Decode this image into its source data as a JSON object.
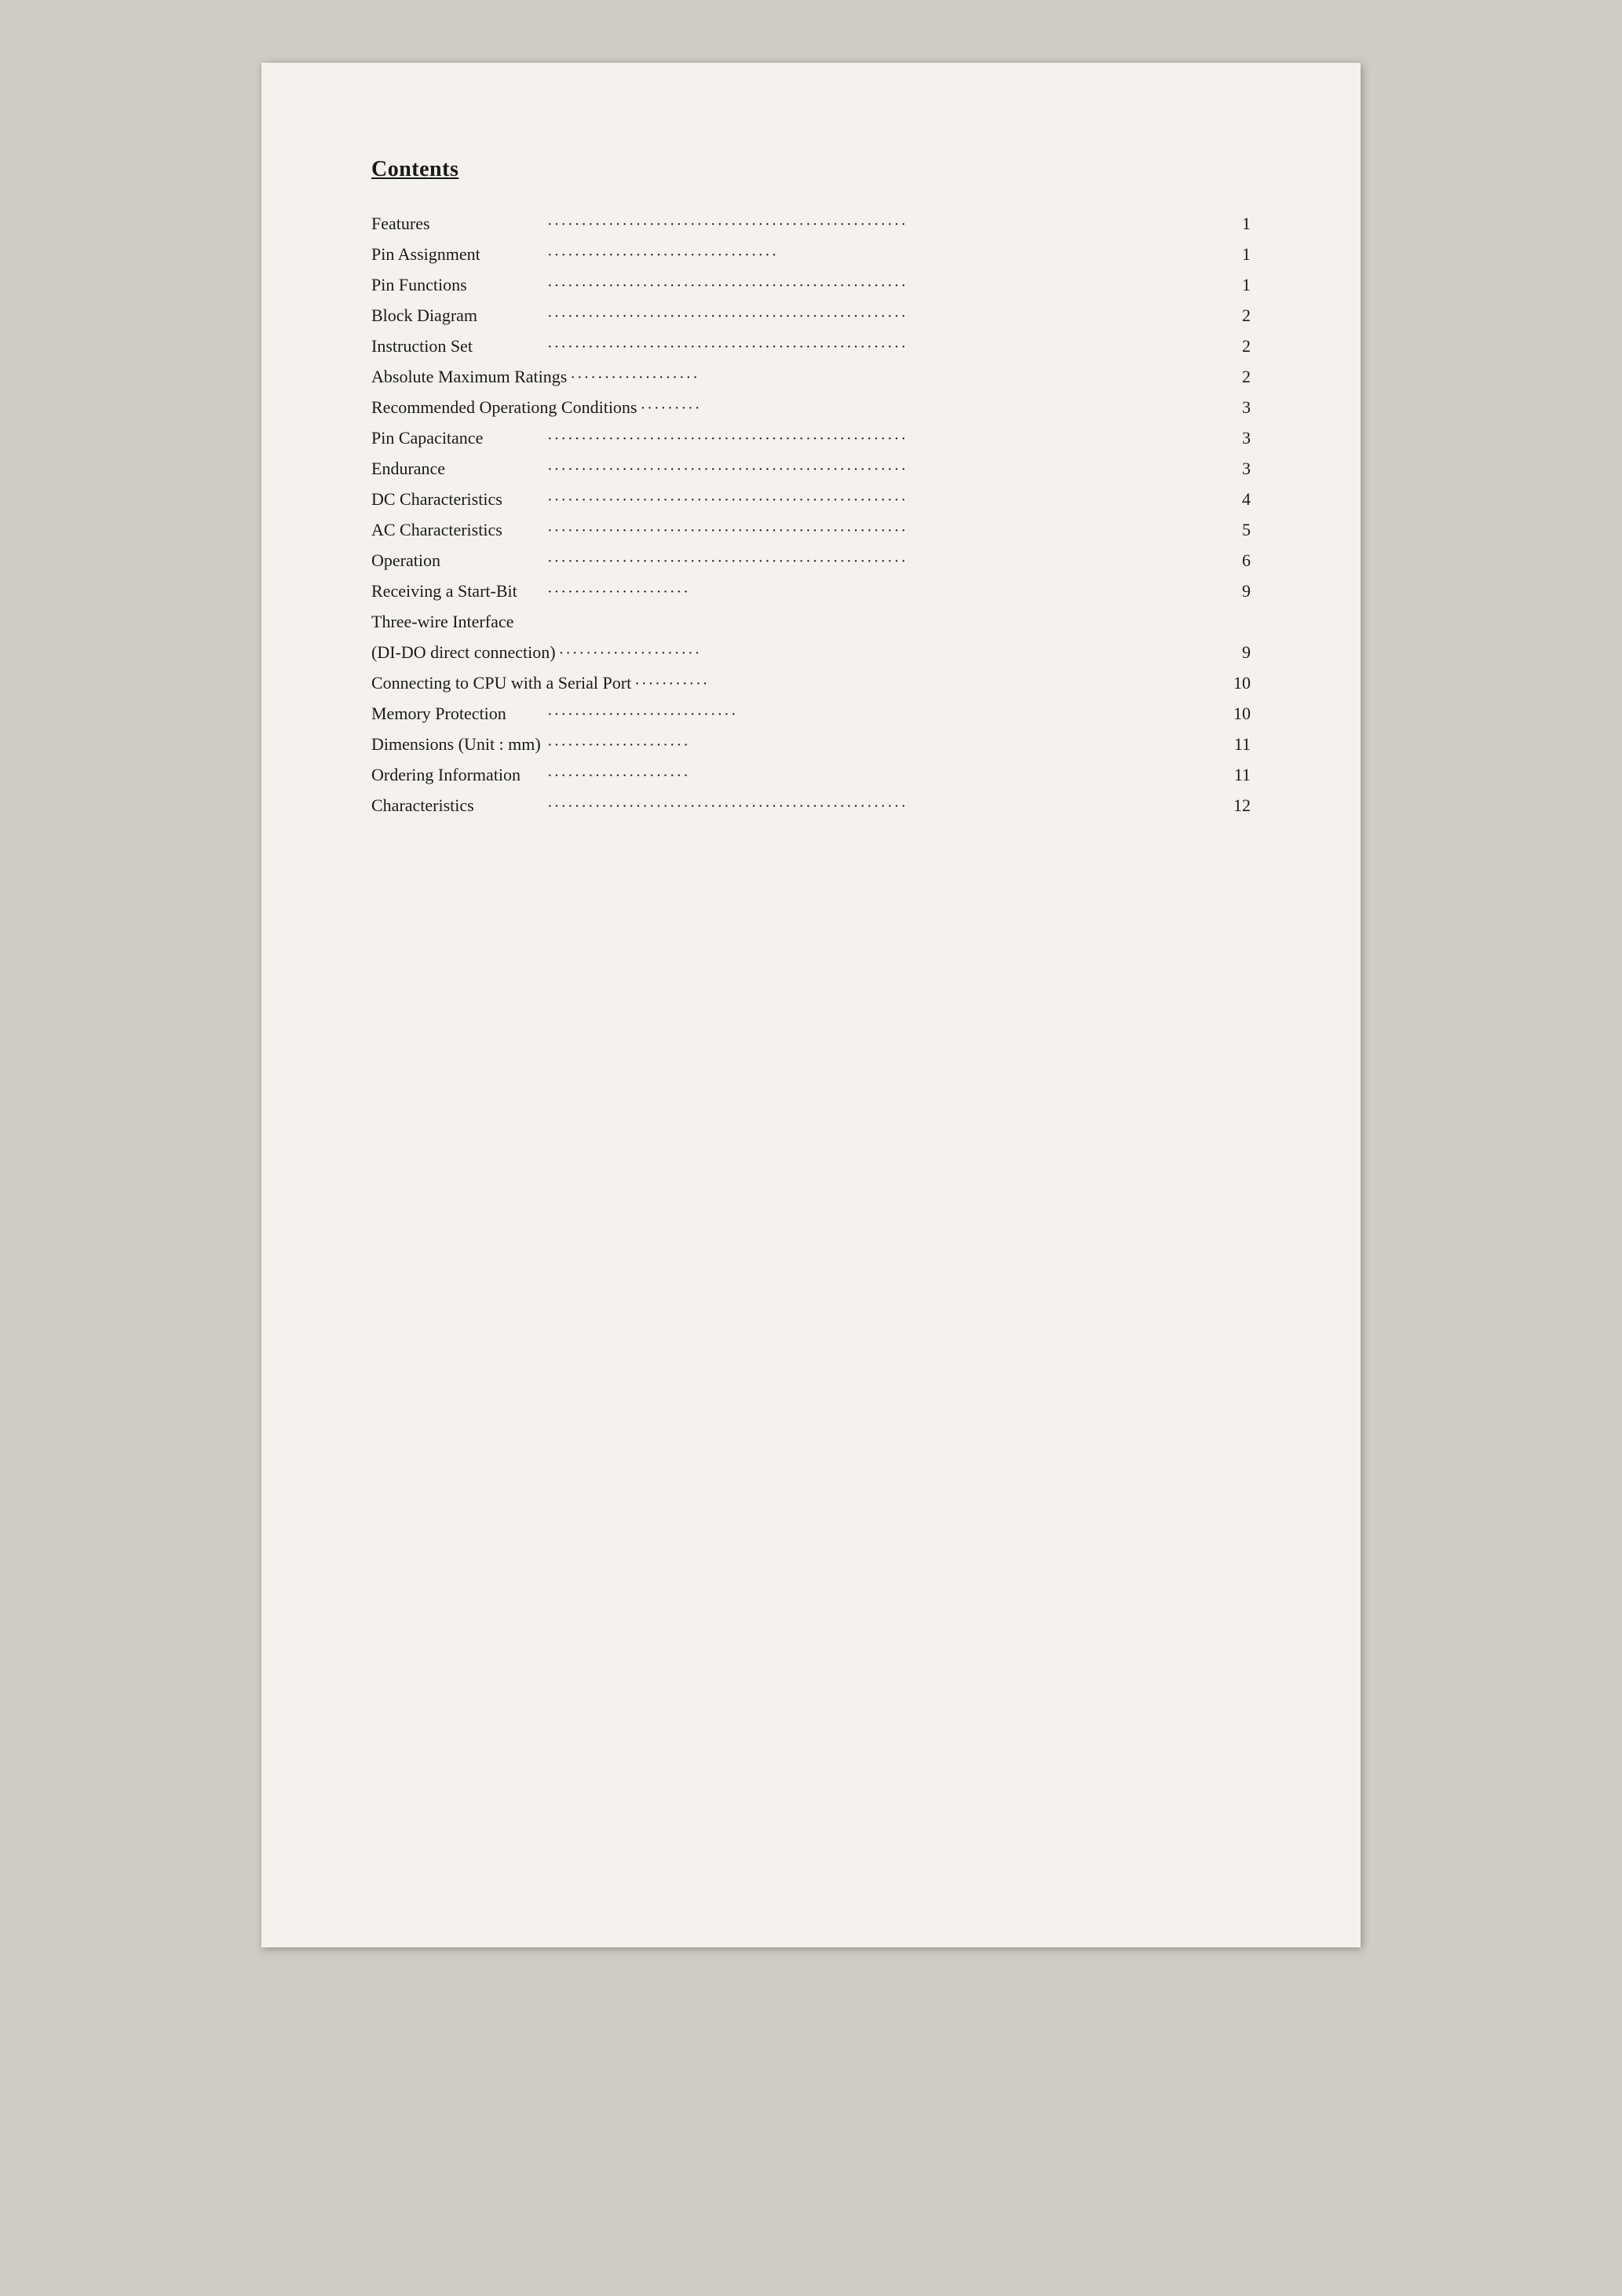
{
  "page": {
    "heading": "Contents",
    "entries": [
      {
        "label": "Features",
        "dots": "·····················································",
        "page": "1"
      },
      {
        "label": "Pin Assignment",
        "dots": "··································",
        "page": "1"
      },
      {
        "label": "Pin Functions",
        "dots": "·····················································",
        "page": "1"
      },
      {
        "label": "Block Diagram",
        "dots": "·····················································",
        "page": "2"
      },
      {
        "label": "Instruction Set",
        "dots": "·····················································",
        "page": "2"
      },
      {
        "label": "Absolute Maximum Ratings",
        "dots": "···················",
        "page": "2"
      },
      {
        "label": "Recommended Operationg Conditions",
        "dots": "·········",
        "page": "3"
      },
      {
        "label": "Pin Capacitance",
        "dots": "·····················································",
        "page": "3"
      },
      {
        "label": "Endurance",
        "dots": "·····················································",
        "page": "3"
      },
      {
        "label": "DC Characteristics",
        "dots": "·····················································",
        "page": "4"
      },
      {
        "label": "AC Characteristics",
        "dots": "·····················································",
        "page": "5"
      },
      {
        "label": "Operation",
        "dots": "·····················································",
        "page": "6"
      },
      {
        "label": "Receiving a Start-Bit",
        "dots": "·····················",
        "page": "9"
      },
      {
        "label": "Three-wire Interface",
        "dots": "",
        "page": ""
      },
      {
        "label": "(DI-DO direct connection)",
        "dots": "·····················",
        "page": "9"
      },
      {
        "label": "Connecting to CPU with a Serial Port",
        "dots": "···········",
        "page": "10"
      },
      {
        "label": "Memory Protection",
        "dots": "····························",
        "page": "10"
      },
      {
        "label": "Dimensions (Unit : mm)",
        "dots": "·····················",
        "page": "11"
      },
      {
        "label": "Ordering Information",
        "dots": "·····················",
        "page": "11"
      },
      {
        "label": "Characteristics",
        "dots": "·····················································",
        "page": "12"
      }
    ]
  }
}
